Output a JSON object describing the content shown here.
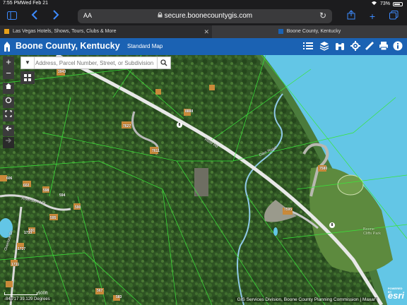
{
  "status_bar": {
    "time": "7:55 PM",
    "date": "Wed Feb 21",
    "battery": "73%"
  },
  "browser": {
    "aa_label": "AA",
    "url": "secure.boonecountygis.com",
    "tabs": [
      {
        "label": "Las Vegas Hotels, Shows, Tours, Clubs & More",
        "active": false
      },
      {
        "label": "Boone County, Kentucky",
        "active": true
      }
    ]
  },
  "app": {
    "title": "Boone County, Kentucky",
    "basemap_label": "Standard Map",
    "header_color": "#1b62b3",
    "toolbar_icons": [
      "list-icon",
      "layers-icon",
      "binoculars-icon",
      "tools-icon",
      "measure-icon",
      "print-icon",
      "info-icon"
    ]
  },
  "search": {
    "placeholder": "Address, Parcel Number, Street, or Subdivision"
  },
  "map": {
    "zoom_in": "+",
    "zoom_out": "−",
    "parcel_labels": [
      {
        "text": "3943"
      },
      {
        "text": "7627"
      },
      {
        "text": "7611"
      },
      {
        "text": "8888"
      },
      {
        "text": "7595"
      },
      {
        "text": "7580"
      },
      {
        "text": "606"
      },
      {
        "text": "602"
      },
      {
        "text": "598"
      },
      {
        "text": "594"
      },
      {
        "text": "590"
      },
      {
        "text": "595"
      },
      {
        "text": "591"
      },
      {
        "text": "1733"
      },
      {
        "text": "1727"
      },
      {
        "text": "1731"
      },
      {
        "text": "567"
      },
      {
        "text": "583"
      }
    ],
    "road_labels": {
      "river_rd": "River Rd",
      "riversbend": "Riversbend Dr",
      "overlook": "Overlook Dr",
      "dam_road": "Dam Road"
    },
    "route_shield": "8",
    "park_label": "Boone Cliffs Park",
    "scale_label": "500ft",
    "coordinates": "-84.717 39.129 Degrees",
    "attribution": "GIS Services Division, Boone County Planning Commission | Maxar",
    "esri_powered": "POWERED BY",
    "esri_logo": "esri"
  }
}
